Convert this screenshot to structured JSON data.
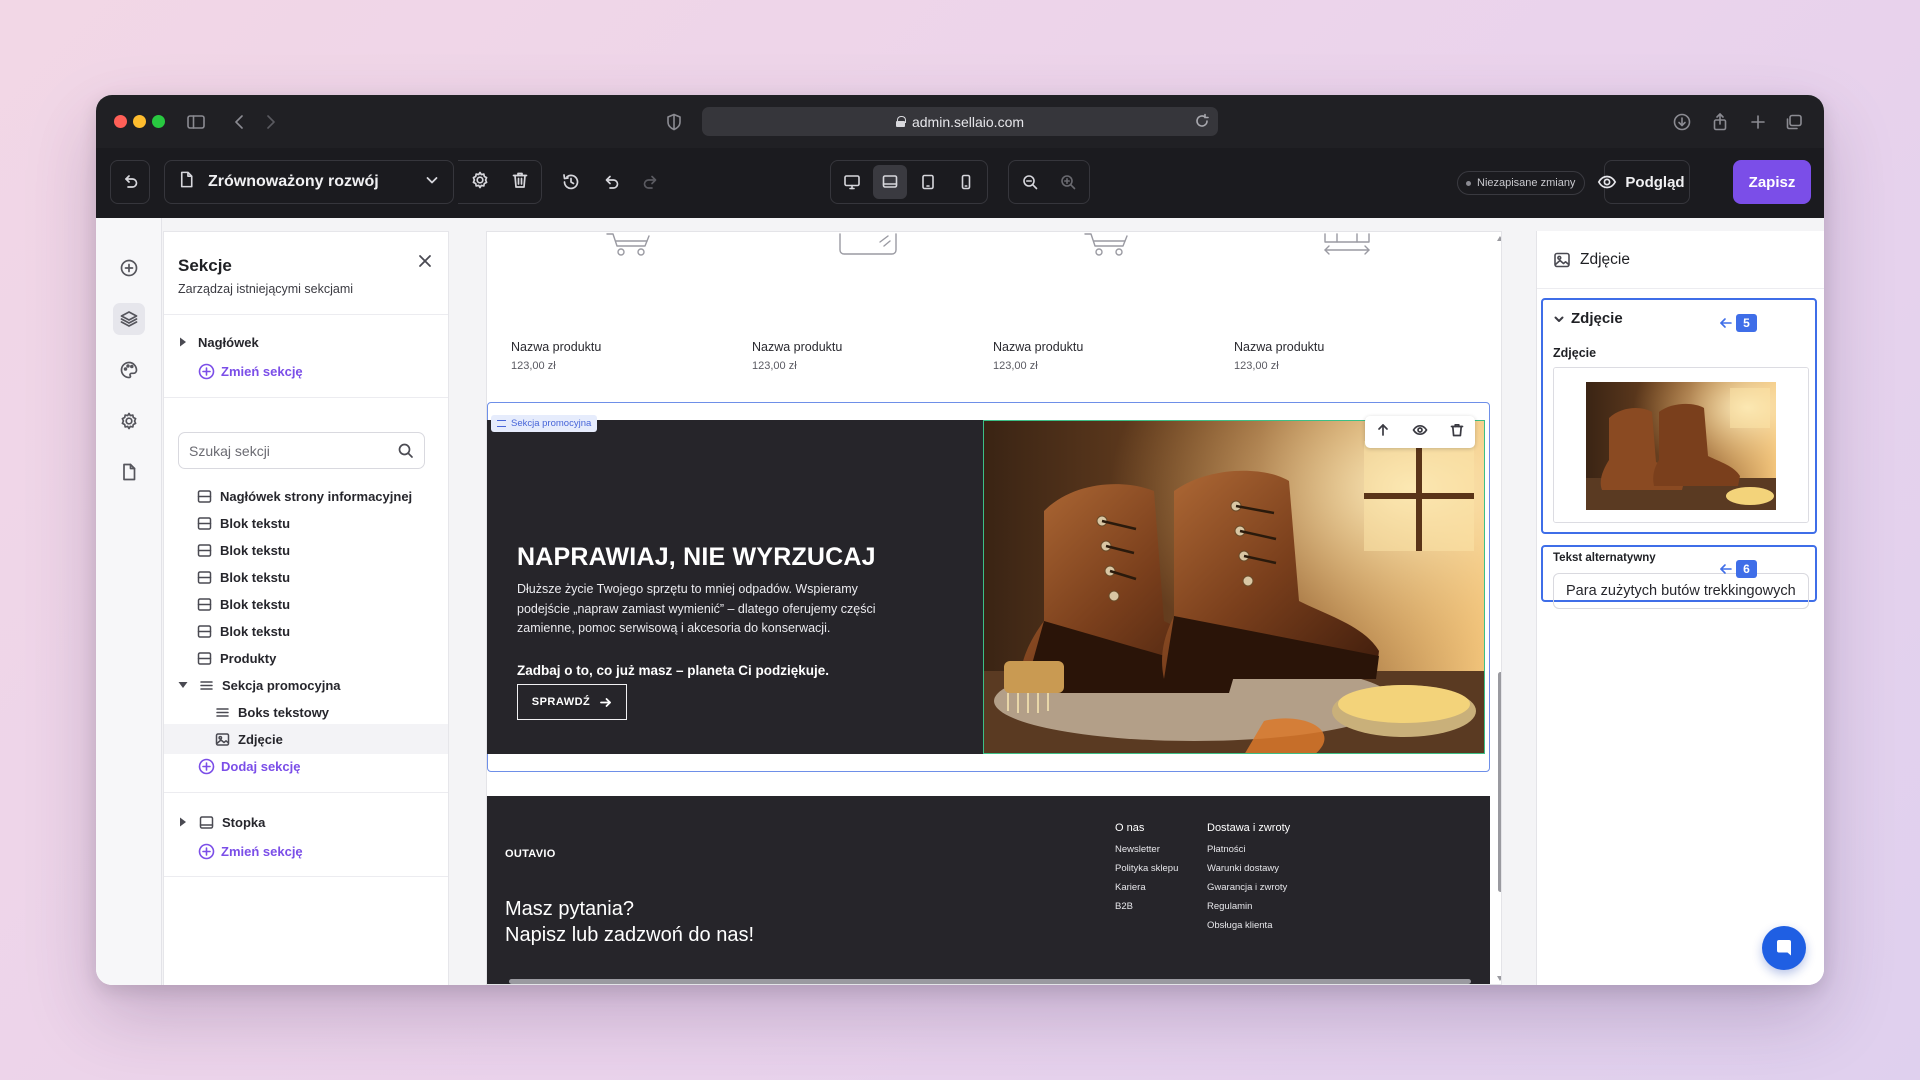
{
  "browser": {
    "url": "admin.sellaio.com"
  },
  "toolbar": {
    "page_name": "Zrównoważony rozwój",
    "unsaved_label": "Niezapisane zmiany",
    "preview_label": "Podgląd",
    "save_label": "Zapisz"
  },
  "sections_panel": {
    "title": "Sekcje",
    "subtitle": "Zarządzaj istniejącymi sekcjami",
    "header_item": "Nagłówek",
    "change_section_label": "Zmień sekcję",
    "search_placeholder": "Szukaj sekcji",
    "items": [
      "Nagłówek strony informacyjnej",
      "Blok tekstu",
      "Blok tekstu",
      "Blok tekstu",
      "Blok tekstu",
      "Blok tekstu",
      "Produkty",
      "Sekcja promocyjna",
      "Boks tekstowy",
      "Zdjęcie"
    ],
    "add_section_label": "Dodaj sekcję",
    "footer_item": "Stopka",
    "footer_change_label": "Zmień sekcję"
  },
  "canvas": {
    "products": [
      {
        "name": "Nazwa produktu",
        "price": "123,00 zł"
      },
      {
        "name": "Nazwa produktu",
        "price": "123,00 zł"
      },
      {
        "name": "Nazwa produktu",
        "price": "123,00 zł"
      },
      {
        "name": "Nazwa produktu",
        "price": "123,00 zł"
      }
    ],
    "promo": {
      "tag": "Sekcja promocyjna",
      "heading": "NAPRAWIAJ, NIE WYRZUCAJ",
      "body": "Dłuższe życie Twojego sprzętu to mniej odpadów. Wspieramy podejście „napraw zamiast wymienić” – dlatego oferujemy części zamienne, pomoc serwisową i akcesoria do konserwacji.",
      "bold_line": "Zadbaj o to, co już masz – planeta Ci podziękuje.",
      "button": "SPRAWDŹ"
    },
    "footer": {
      "logo": "OUTAVIO",
      "question_line1": "Masz pytania?",
      "question_line2": "Napisz lub zadzwoń do nas!",
      "col1": {
        "title": "O nas",
        "links": [
          "Newsletter",
          "Polityka sklepu",
          "Kariera",
          "B2B"
        ]
      },
      "col2": {
        "title": "Dostawa i zwroty",
        "links": [
          "Płatności",
          "Warunki dostawy",
          "Gwarancja i zwroty",
          "Regulamin",
          "Obsługa klienta"
        ]
      }
    }
  },
  "right_panel": {
    "header": "Zdjęcie",
    "group_title": "Zdjęcie",
    "image_label": "Zdjęcie",
    "alt_label": "Tekst alternatywny",
    "alt_value": "Para zużytych butów trekkingowych",
    "annotations": [
      "5",
      "6"
    ]
  },
  "colors": {
    "accent": "#7b4ee8",
    "selection": "#3f6ee8",
    "image_outline": "#3cbf86"
  }
}
